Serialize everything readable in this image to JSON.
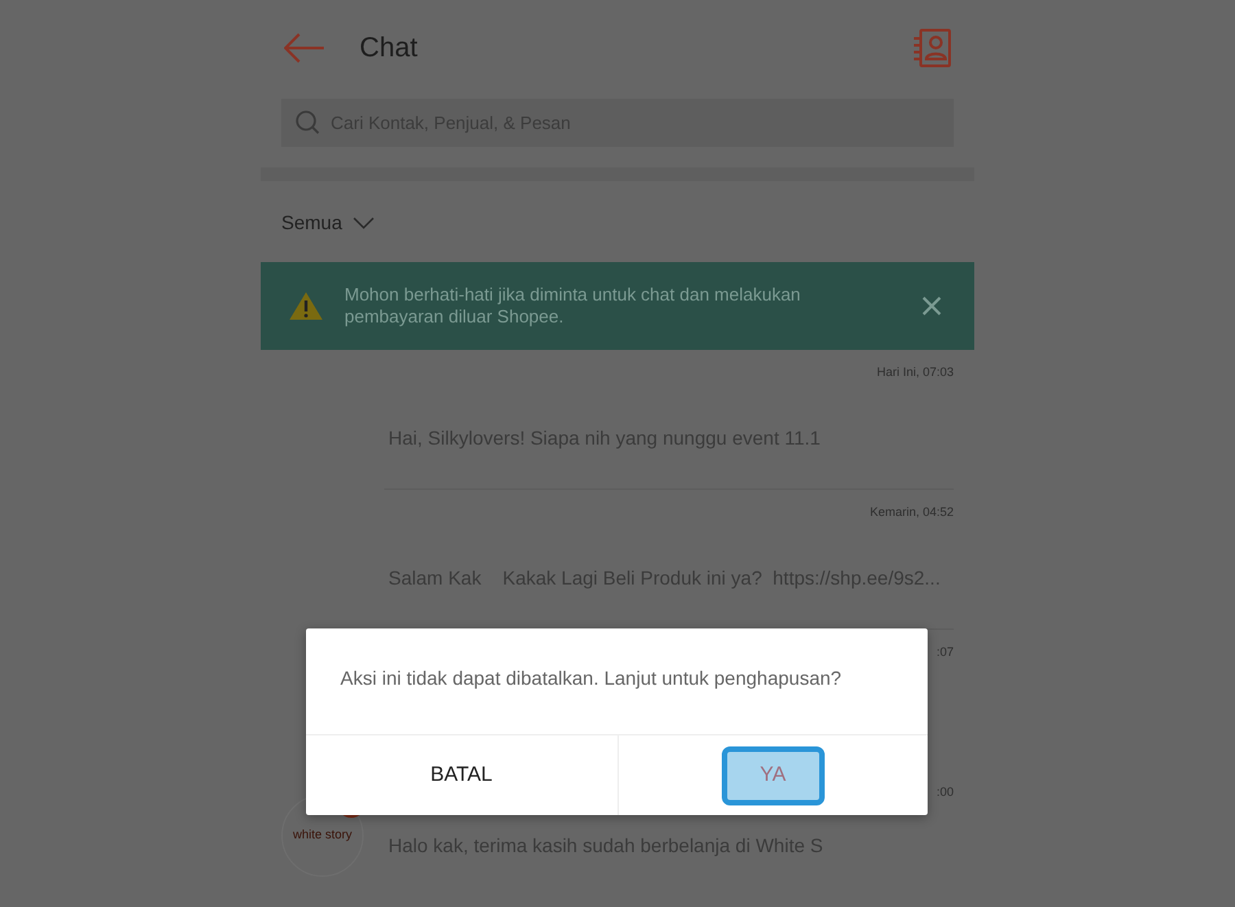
{
  "header": {
    "title": "Chat"
  },
  "search": {
    "placeholder": "Cari Kontak, Penjual, & Pesan"
  },
  "filter": {
    "label": "Semua"
  },
  "warning_banner": {
    "text": "Mohon berhati-hati jika diminta untuk chat dan melakukan pembayaran diluar Shopee."
  },
  "chats": [
    {
      "kind": "message",
      "time": "Hari Ini, 07:03",
      "message": "Hai, Silkylovers! Siapa nih yang nunggu event 11.1"
    },
    {
      "kind": "message",
      "time": "Kemarin, 04:52",
      "message": "Salam Kak    Kakak Lagi Beli Produk ini ya?  https://shp.ee/9s2..."
    },
    {
      "kind": "covered",
      "time": ":07"
    },
    {
      "kind": "avatar",
      "time": ":00",
      "avatar_text": "white story",
      "message": "Halo kak, terima kasih sudah berbelanja di White S"
    }
  ],
  "dialog": {
    "message": "Aksi ini tidak dapat dibatalkan. Lanjut untuk penghapusan?",
    "buttons": [
      {
        "label": "BATAL",
        "selected": false
      },
      {
        "label": "YA",
        "selected": true
      }
    ]
  }
}
